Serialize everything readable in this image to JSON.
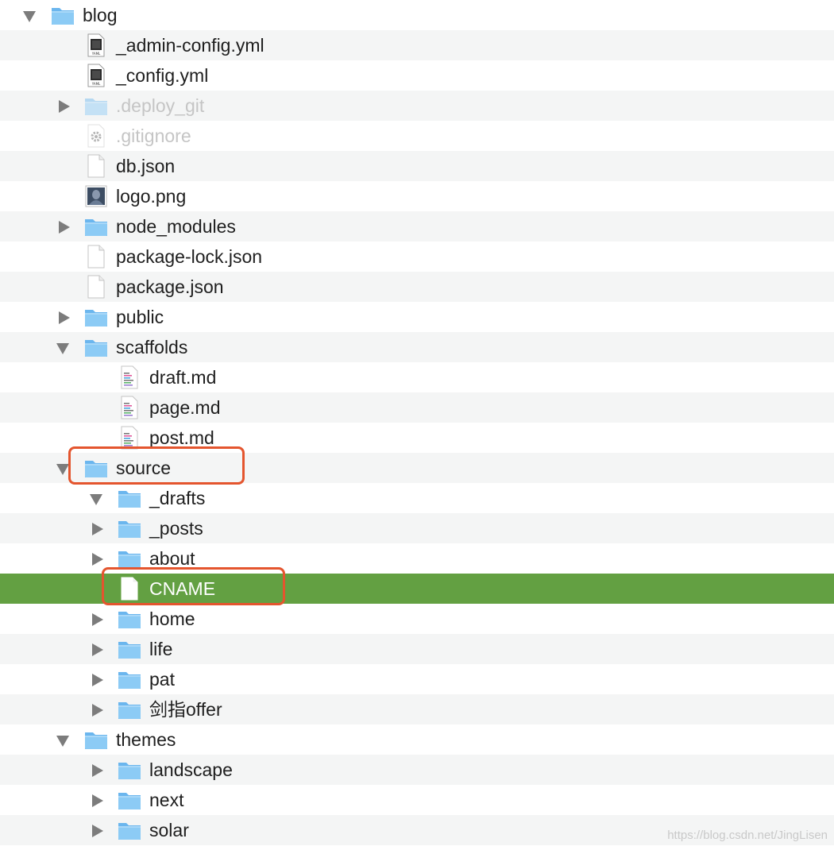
{
  "tree": [
    {
      "label": "blog",
      "type": "folder",
      "depth": 0,
      "expanded": true
    },
    {
      "label": "_admin-config.yml",
      "type": "yaml",
      "depth": 1
    },
    {
      "label": "_config.yml",
      "type": "yaml",
      "depth": 1
    },
    {
      "label": ".deploy_git",
      "type": "folder",
      "depth": 1,
      "expanded": false,
      "dim": true
    },
    {
      "label": ".gitignore",
      "type": "gear",
      "depth": 1,
      "dim": true
    },
    {
      "label": "db.json",
      "type": "file",
      "depth": 1
    },
    {
      "label": "logo.png",
      "type": "image",
      "depth": 1
    },
    {
      "label": "node_modules",
      "type": "folder",
      "depth": 1,
      "expanded": false
    },
    {
      "label": "package-lock.json",
      "type": "file",
      "depth": 1
    },
    {
      "label": "package.json",
      "type": "file",
      "depth": 1
    },
    {
      "label": "public",
      "type": "folder",
      "depth": 1,
      "expanded": false
    },
    {
      "label": "scaffolds",
      "type": "folder",
      "depth": 1,
      "expanded": true
    },
    {
      "label": "draft.md",
      "type": "md",
      "depth": 2
    },
    {
      "label": "page.md",
      "type": "md",
      "depth": 2
    },
    {
      "label": "post.md",
      "type": "md",
      "depth": 2
    },
    {
      "label": "source",
      "type": "folder",
      "depth": 1,
      "expanded": true,
      "highlight": true
    },
    {
      "label": "_drafts",
      "type": "folder",
      "depth": 2,
      "expanded": true
    },
    {
      "label": "_posts",
      "type": "folder",
      "depth": 2,
      "expanded": false
    },
    {
      "label": "about",
      "type": "folder",
      "depth": 2,
      "expanded": false
    },
    {
      "label": "CNAME",
      "type": "file",
      "depth": 2,
      "selected": true,
      "highlight": true
    },
    {
      "label": "home",
      "type": "folder",
      "depth": 2,
      "expanded": false
    },
    {
      "label": "life",
      "type": "folder",
      "depth": 2,
      "expanded": false
    },
    {
      "label": "pat",
      "type": "folder",
      "depth": 2,
      "expanded": false
    },
    {
      "label": "剑指offer",
      "type": "folder",
      "depth": 2,
      "expanded": false
    },
    {
      "label": "themes",
      "type": "folder",
      "depth": 1,
      "expanded": true
    },
    {
      "label": "landscape",
      "type": "folder",
      "depth": 2,
      "expanded": false
    },
    {
      "label": "next",
      "type": "folder",
      "depth": 2,
      "expanded": false
    },
    {
      "label": "solar",
      "type": "folder",
      "depth": 2,
      "expanded": false
    }
  ],
  "watermark": "https://blog.csdn.net/JingLisen",
  "colors": {
    "selection": "#63a042",
    "highlight_box": "#e4552e",
    "alt_row": "#f4f5f5",
    "folder": "#7ec3f2"
  }
}
